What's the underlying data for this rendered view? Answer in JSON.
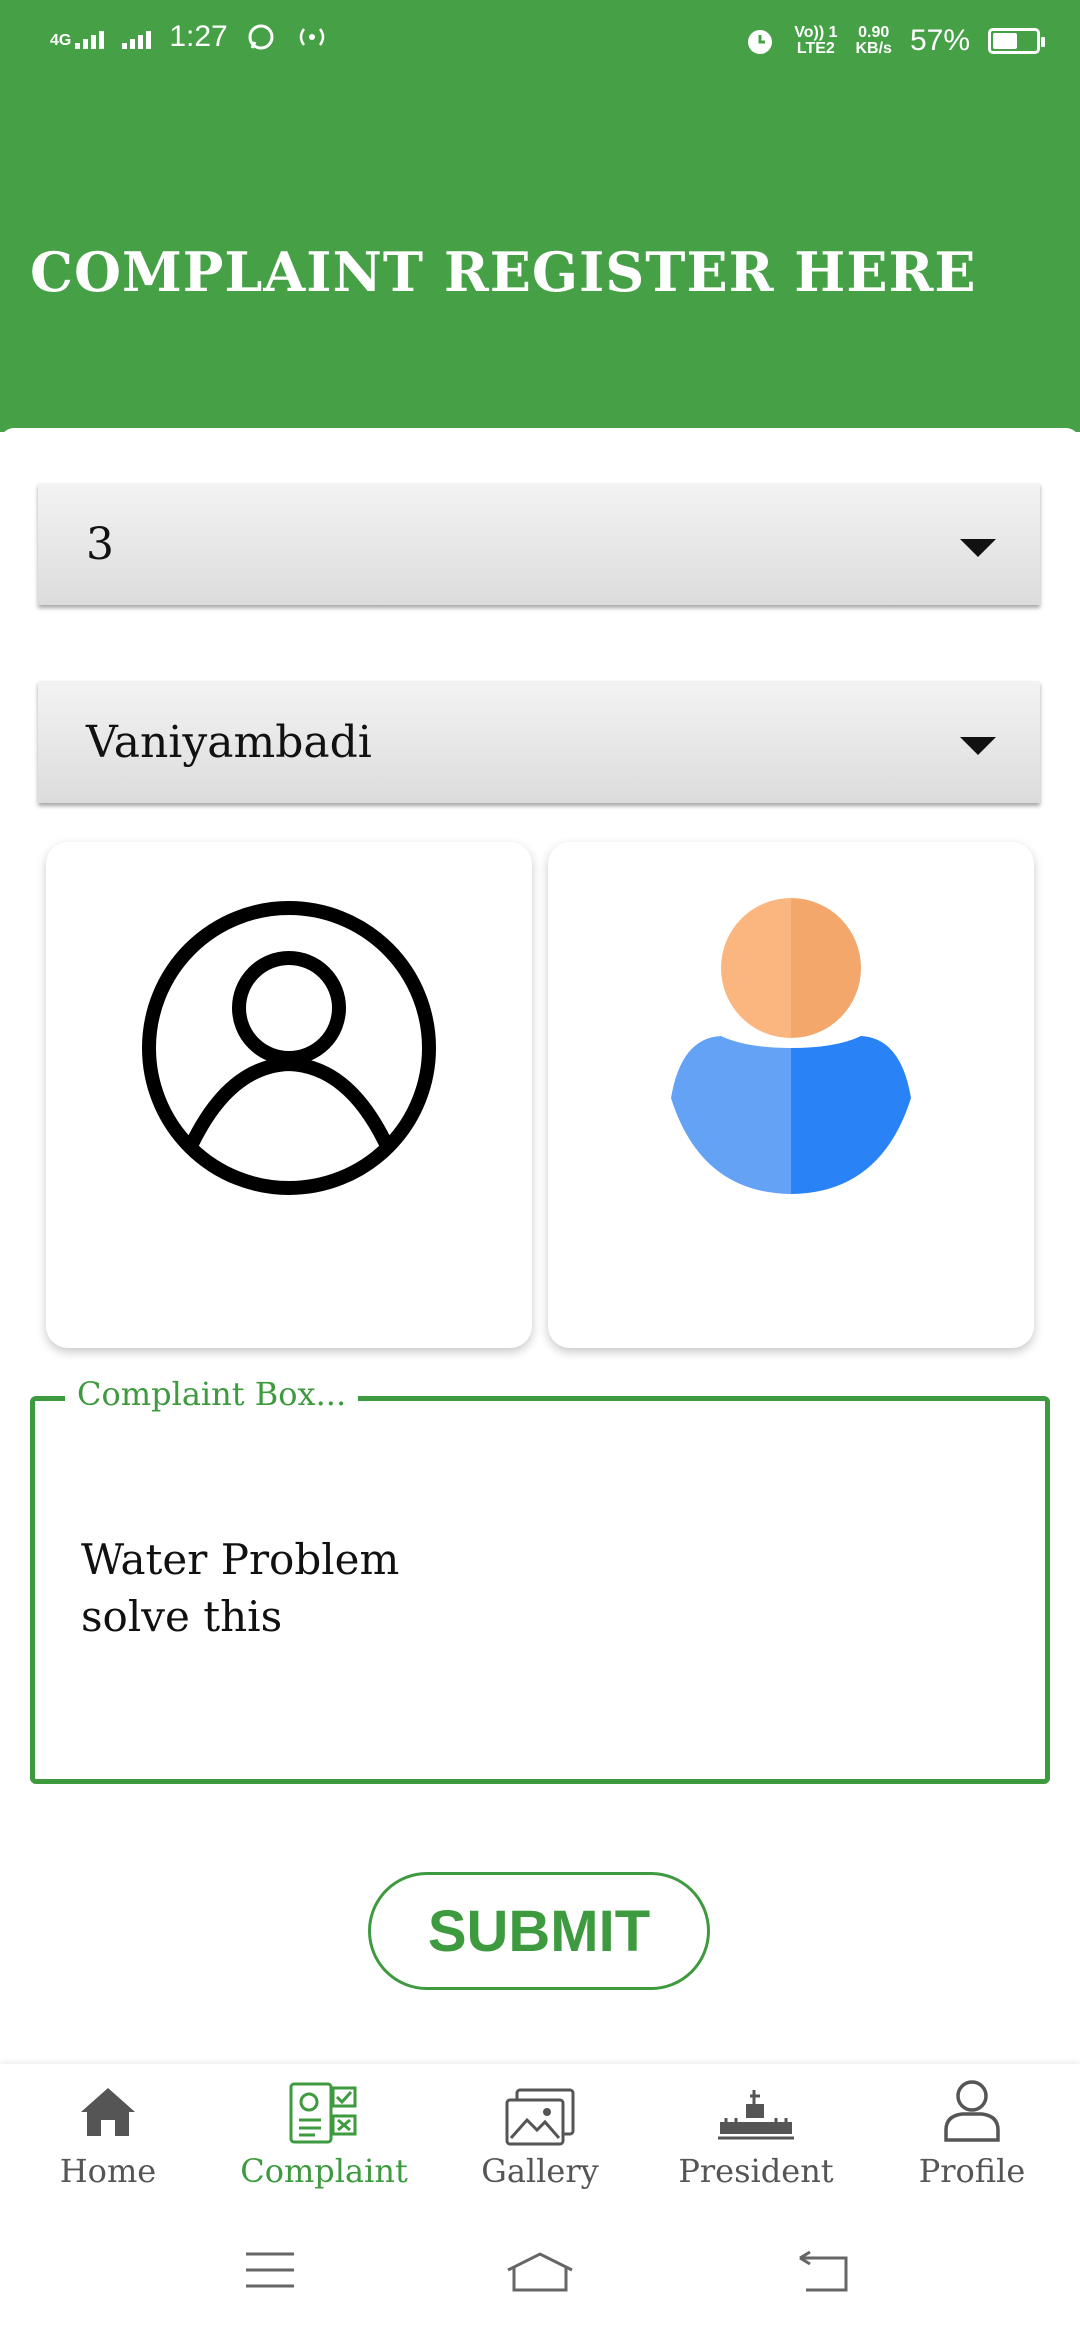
{
  "status_bar": {
    "network": "4G",
    "time": "1:27",
    "volte": "Vo)) 1",
    "lte": "LTE2",
    "speed_value": "0.90",
    "speed_unit": "KB/s",
    "battery": "57%",
    "battery_level": 0.57
  },
  "header": {
    "title": "COMPLAINT REGISTER HERE",
    "color": "#46a046"
  },
  "form": {
    "ward_select": {
      "value": "3"
    },
    "area_select": {
      "value": "Vaniyambadi"
    },
    "complaint": {
      "legend": "Complaint Box...",
      "value": "Water Problem\nsolve this"
    },
    "submit_label": "SUBMIT"
  },
  "bottom_nav": {
    "items": [
      {
        "label": "Home",
        "icon": "home-icon"
      },
      {
        "label": "Complaint",
        "icon": "complaint-icon",
        "active": true
      },
      {
        "label": "Gallery",
        "icon": "gallery-icon"
      },
      {
        "label": "President",
        "icon": "president-icon"
      },
      {
        "label": "Profile",
        "icon": "profile-icon"
      }
    ],
    "active_color": "#3e9a3e"
  },
  "system_nav": [
    "menu-icon",
    "home-outline-icon",
    "back-icon"
  ]
}
